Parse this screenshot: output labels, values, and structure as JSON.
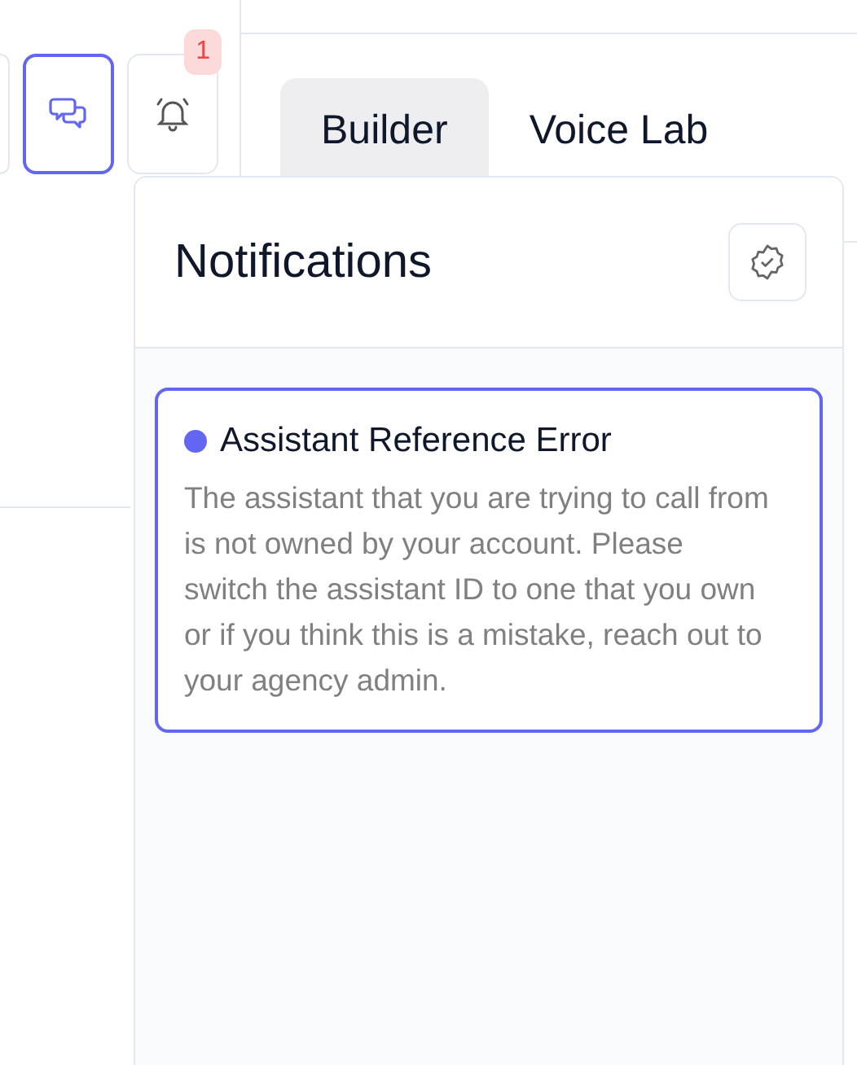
{
  "toolbar": {
    "buttons": [
      {
        "kind": "partial",
        "selected": false
      },
      {
        "kind": "chat",
        "selected": true
      },
      {
        "kind": "bell",
        "selected": false,
        "badge": "1"
      }
    ]
  },
  "tabs": [
    {
      "label": "Builder",
      "selected": true
    },
    {
      "label": "Voice Lab",
      "selected": false
    }
  ],
  "notifications": {
    "title": "Notifications",
    "items": [
      {
        "title": "Assistant Reference Error",
        "body": "The assistant that you are trying to call from is not owned by your account. Please switch the assistant ID to one that you own or if you think this is a mistake, reach out to your agency admin.",
        "unread": true
      }
    ]
  }
}
